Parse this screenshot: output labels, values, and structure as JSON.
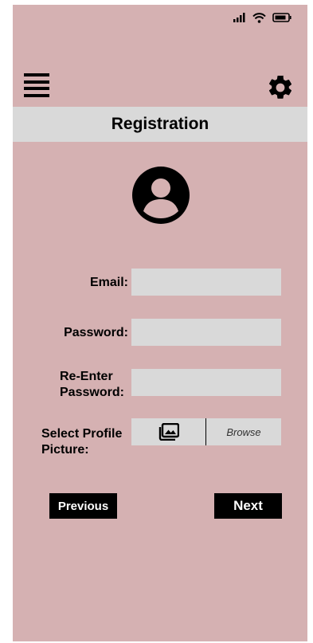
{
  "icons": {
    "signal": "signal-icon",
    "wifi": "wifi-icon",
    "battery": "battery-icon",
    "menu": "hamburger-menu-icon",
    "settings": "gear-icon",
    "avatar": "user-avatar-icon",
    "image": "image-gallery-icon"
  },
  "colors": {
    "background": "#d5b1b2",
    "bar": "#d9d9d9",
    "button": "#000000"
  },
  "header": {
    "title": "Registration"
  },
  "form": {
    "email_label": "Email:",
    "email_value": "",
    "password_label": "Password:",
    "password_value": "",
    "reenter_label_line1": "Re-Enter",
    "reenter_label_line2": "Password:",
    "reenter_value": "",
    "picture_label_line1": "Select Profile",
    "picture_label_line2": "Picture:",
    "browse_label": "Browse"
  },
  "nav": {
    "previous_label": "Previous",
    "next_label": "Next"
  }
}
